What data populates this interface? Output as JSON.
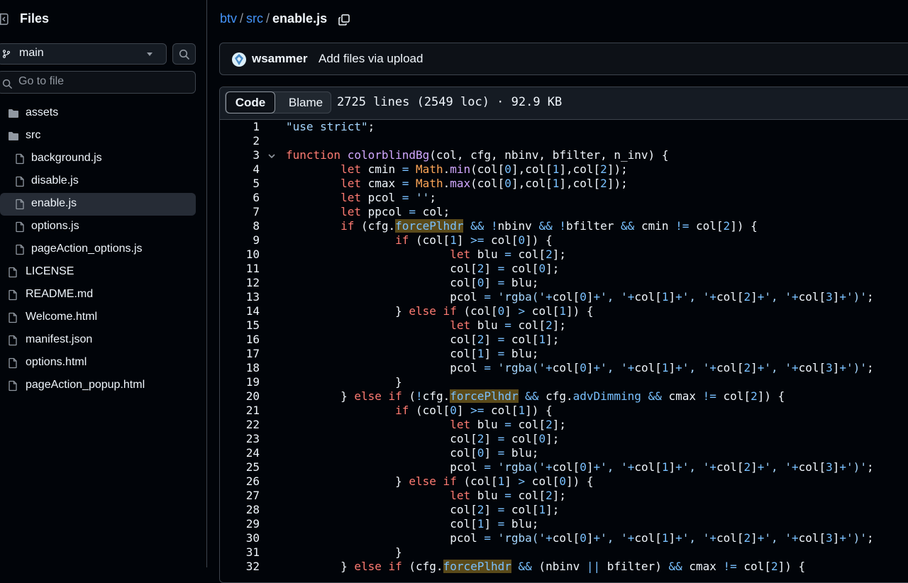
{
  "sidebar": {
    "title": "Files",
    "branch": "main",
    "search_placeholder": "Go to file",
    "items": [
      {
        "label": "assets",
        "type": "folder-closed",
        "level": 0
      },
      {
        "label": "src",
        "type": "folder-open",
        "level": 0
      },
      {
        "label": "background.js",
        "type": "file",
        "level": 1
      },
      {
        "label": "disable.js",
        "type": "file",
        "level": 1
      },
      {
        "label": "enable.js",
        "type": "file",
        "level": 1,
        "selected": true
      },
      {
        "label": "options.js",
        "type": "file",
        "level": 1
      },
      {
        "label": "pageAction_options.js",
        "type": "file",
        "level": 1
      },
      {
        "label": "LICENSE",
        "type": "file",
        "level": 0
      },
      {
        "label": "README.md",
        "type": "file",
        "level": 0
      },
      {
        "label": "Welcome.html",
        "type": "file",
        "level": 0
      },
      {
        "label": "manifest.json",
        "type": "file",
        "level": 0
      },
      {
        "label": "options.html",
        "type": "file",
        "level": 0
      },
      {
        "label": "pageAction_popup.html",
        "type": "file",
        "level": 0
      }
    ]
  },
  "breadcrumb": {
    "repo": "btv",
    "sep": "/",
    "folder": "src",
    "file": "enable.js"
  },
  "commit": {
    "author": "wsammer",
    "message": "Add files via upload"
  },
  "file_header": {
    "tab_code": "Code",
    "tab_blame": "Blame",
    "info": "2725 lines (2549 loc) · 92.9 KB"
  },
  "code_lines": [
    {
      "n": "1",
      "html": "<span class=\"str\">\"use strict\"</span>;"
    },
    {
      "n": "2",
      "html": ""
    },
    {
      "n": "3",
      "fold": true,
      "html": "<span class=\"kw\">function</span> <span class=\"fn\">colorblindBg</span>(col, cfg, nbinv, bfilter, n_inv) {"
    },
    {
      "n": "4",
      "html": "\t<span class=\"kw\">let</span> cmin <span class=\"op\">=</span> <span class=\"cl\">Math</span>.<span class=\"fn\">min</span>(col[<span class=\"num\">0</span>],col[<span class=\"num\">1</span>],col[<span class=\"num\">2</span>]);"
    },
    {
      "n": "5",
      "html": "\t<span class=\"kw\">let</span> cmax <span class=\"op\">=</span> <span class=\"cl\">Math</span>.<span class=\"fn\">max</span>(col[<span class=\"num\">0</span>],col[<span class=\"num\">1</span>],col[<span class=\"num\">2</span>]);"
    },
    {
      "n": "6",
      "html": "\t<span class=\"kw\">let</span> pcol <span class=\"op\">=</span> <span class=\"str\">''</span>;"
    },
    {
      "n": "7",
      "html": "\t<span class=\"kw\">let</span> ppcol <span class=\"op\">=</span> col;"
    },
    {
      "n": "8",
      "html": "\t<span class=\"kw\">if</span> (cfg.<span class=\"op hl\">forcePlhdr</span> <span class=\"op\">&amp;&amp;</span> <span class=\"op\">!</span>nbinv <span class=\"op\">&amp;&amp;</span> <span class=\"op\">!</span>bfilter <span class=\"op\">&amp;&amp;</span> cmin <span class=\"op\">!=</span> col[<span class=\"num\">2</span>]) {"
    },
    {
      "n": "9",
      "html": "\t\t<span class=\"kw\">if</span> (col[<span class=\"num\">1</span>] <span class=\"op\">&gt;=</span> col[<span class=\"num\">0</span>]) {"
    },
    {
      "n": "10",
      "html": "\t\t\t<span class=\"kw\">let</span> blu <span class=\"op\">=</span> col[<span class=\"num\">2</span>];"
    },
    {
      "n": "11",
      "html": "\t\t\tcol[<span class=\"num\">2</span>] <span class=\"op\">=</span> col[<span class=\"num\">0</span>];"
    },
    {
      "n": "12",
      "html": "\t\t\tcol[<span class=\"num\">0</span>] <span class=\"op\">=</span> blu;"
    },
    {
      "n": "13",
      "html": "\t\t\tpcol <span class=\"op\">=</span> <span class=\"str\">'rgba('</span><span class=\"op\">+</span>col[<span class=\"num\">0</span>]<span class=\"op\">+</span><span class=\"str\">', '</span><span class=\"op\">+</span>col[<span class=\"num\">1</span>]<span class=\"op\">+</span><span class=\"str\">', '</span><span class=\"op\">+</span>col[<span class=\"num\">2</span>]<span class=\"op\">+</span><span class=\"str\">', '</span><span class=\"op\">+</span>col[<span class=\"num\">3</span>]<span class=\"op\">+</span><span class=\"str\">')'</span>;"
    },
    {
      "n": "14",
      "html": "\t\t} <span class=\"kw\">else if</span> (col[<span class=\"num\">0</span>] <span class=\"op\">&gt;</span> col[<span class=\"num\">1</span>]) {"
    },
    {
      "n": "15",
      "html": "\t\t\t<span class=\"kw\">let</span> blu <span class=\"op\">=</span> col[<span class=\"num\">2</span>];"
    },
    {
      "n": "16",
      "html": "\t\t\tcol[<span class=\"num\">2</span>] <span class=\"op\">=</span> col[<span class=\"num\">1</span>];"
    },
    {
      "n": "17",
      "html": "\t\t\tcol[<span class=\"num\">1</span>] <span class=\"op\">=</span> blu;"
    },
    {
      "n": "18",
      "html": "\t\t\tpcol <span class=\"op\">=</span> <span class=\"str\">'rgba('</span><span class=\"op\">+</span>col[<span class=\"num\">0</span>]<span class=\"op\">+</span><span class=\"str\">', '</span><span class=\"op\">+</span>col[<span class=\"num\">1</span>]<span class=\"op\">+</span><span class=\"str\">', '</span><span class=\"op\">+</span>col[<span class=\"num\">2</span>]<span class=\"op\">+</span><span class=\"str\">', '</span><span class=\"op\">+</span>col[<span class=\"num\">3</span>]<span class=\"op\">+</span><span class=\"str\">')'</span>;"
    },
    {
      "n": "19",
      "html": "\t\t}"
    },
    {
      "n": "20",
      "html": "\t} <span class=\"kw\">else if</span> (<span class=\"op\">!</span>cfg.<span class=\"op hl\">forcePlhdr</span> <span class=\"op\">&amp;&amp;</span> cfg.<span class=\"op\">advDimming</span> <span class=\"op\">&amp;&amp;</span> cmax <span class=\"op\">!=</span> col[<span class=\"num\">2</span>]) {"
    },
    {
      "n": "21",
      "html": "\t\t<span class=\"kw\">if</span> (col[<span class=\"num\">0</span>] <span class=\"op\">&gt;=</span> col[<span class=\"num\">1</span>]) {"
    },
    {
      "n": "22",
      "html": "\t\t\t<span class=\"kw\">let</span> blu <span class=\"op\">=</span> col[<span class=\"num\">2</span>];"
    },
    {
      "n": "23",
      "html": "\t\t\tcol[<span class=\"num\">2</span>] <span class=\"op\">=</span> col[<span class=\"num\">0</span>];"
    },
    {
      "n": "24",
      "html": "\t\t\tcol[<span class=\"num\">0</span>] <span class=\"op\">=</span> blu;"
    },
    {
      "n": "25",
      "html": "\t\t\tpcol <span class=\"op\">=</span> <span class=\"str\">'rgba('</span><span class=\"op\">+</span>col[<span class=\"num\">0</span>]<span class=\"op\">+</span><span class=\"str\">', '</span><span class=\"op\">+</span>col[<span class=\"num\">1</span>]<span class=\"op\">+</span><span class=\"str\">', '</span><span class=\"op\">+</span>col[<span class=\"num\">2</span>]<span class=\"op\">+</span><span class=\"str\">', '</span><span class=\"op\">+</span>col[<span class=\"num\">3</span>]<span class=\"op\">+</span><span class=\"str\">')'</span>;"
    },
    {
      "n": "26",
      "html": "\t\t} <span class=\"kw\">else if</span> (col[<span class=\"num\">1</span>] <span class=\"op\">&gt;</span> col[<span class=\"num\">0</span>]) {"
    },
    {
      "n": "27",
      "html": "\t\t\t<span class=\"kw\">let</span> blu <span class=\"op\">=</span> col[<span class=\"num\">2</span>];"
    },
    {
      "n": "28",
      "html": "\t\t\tcol[<span class=\"num\">2</span>] <span class=\"op\">=</span> col[<span class=\"num\">1</span>];"
    },
    {
      "n": "29",
      "html": "\t\t\tcol[<span class=\"num\">1</span>] <span class=\"op\">=</span> blu;"
    },
    {
      "n": "30",
      "html": "\t\t\tpcol <span class=\"op\">=</span> <span class=\"str\">'rgba('</span><span class=\"op\">+</span>col[<span class=\"num\">0</span>]<span class=\"op\">+</span><span class=\"str\">', '</span><span class=\"op\">+</span>col[<span class=\"num\">1</span>]<span class=\"op\">+</span><span class=\"str\">', '</span><span class=\"op\">+</span>col[<span class=\"num\">2</span>]<span class=\"op\">+</span><span class=\"str\">', '</span><span class=\"op\">+</span>col[<span class=\"num\">3</span>]<span class=\"op\">+</span><span class=\"str\">')'</span>;"
    },
    {
      "n": "31",
      "html": "\t\t}"
    },
    {
      "n": "32",
      "html": "\t} <span class=\"kw\">else if</span> (cfg.<span class=\"op hl\">forcePlhdr</span> <span class=\"op\">&amp;&amp;</span> (nbinv <span class=\"op\">||</span> bfilter) <span class=\"op\">&amp;&amp;</span> cmax <span class=\"op\">!=</span> col[<span class=\"num\">2</span>]) {"
    }
  ],
  "colors": {
    "bg": "#010409",
    "panel": "#0d1117",
    "border": "#3d444d",
    "link": "#4493f8",
    "keyword": "#ff7b72",
    "function": "#d2a8ff",
    "string": "#a5d6ff",
    "constant": "#79c0ff",
    "class": "#ffa657",
    "highlight": "#5a4a1a"
  },
  "icons": {
    "sidebar_toggle": "sidebar-collapse-icon",
    "branch": "git-branch-icon",
    "search": "search-icon",
    "folder": "folder-icon",
    "file": "file-icon",
    "copy": "copy-icon",
    "fold": "chevron-down-icon"
  }
}
